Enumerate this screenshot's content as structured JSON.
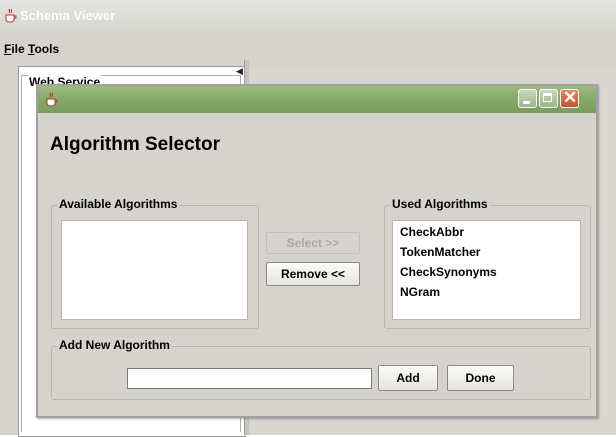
{
  "window": {
    "title": "Schema Viewer"
  },
  "menubar": {
    "items": [
      {
        "mnemonic": "F",
        "rest": "ile"
      },
      {
        "mnemonic": "T",
        "rest": "ools"
      }
    ]
  },
  "left_pane": {
    "group_title": "Web Service"
  },
  "dialog": {
    "heading": "Algorithm Selector",
    "available": {
      "title": "Available Algorithms",
      "items": []
    },
    "used": {
      "title": "Used Algorithms",
      "items": [
        "CheckAbbr",
        "TokenMatcher",
        "CheckSynonyms",
        "NGram"
      ]
    },
    "select_label": "Select >>",
    "remove_label": "Remove <<",
    "add_new": {
      "title": "Add New Algorithm",
      "value": ""
    },
    "add_label": "Add",
    "done_label": "Done"
  },
  "colors": {
    "dialog_titlebar": "#86a86a",
    "close_button": "#c4512c",
    "window_bg": "#d6d3ce"
  },
  "icons": [
    "java-cup-icon",
    "minimize-icon",
    "maximize-icon",
    "close-icon"
  ]
}
